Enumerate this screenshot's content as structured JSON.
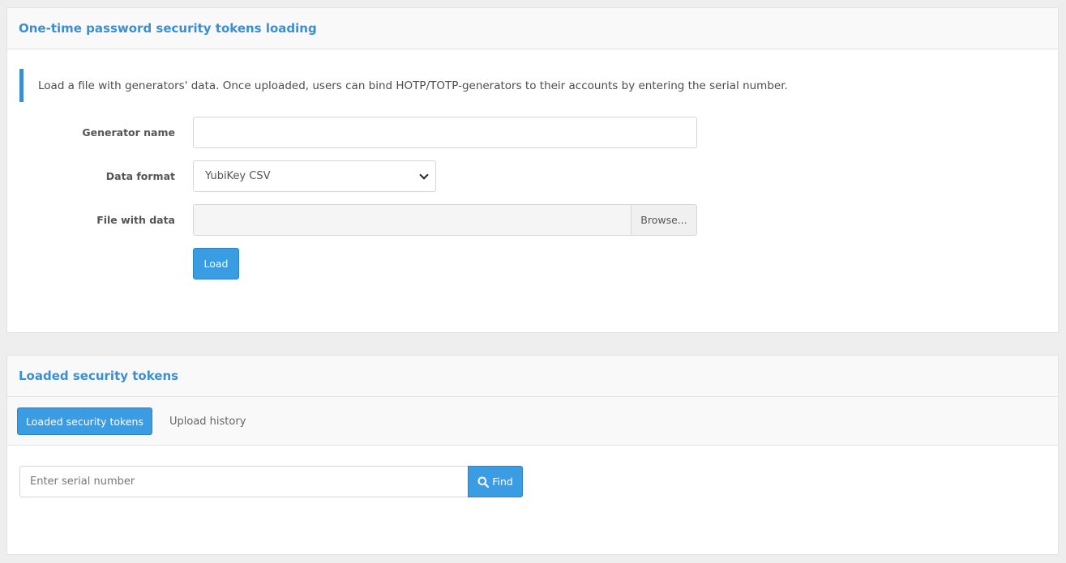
{
  "upload_panel": {
    "title": "One-time password security tokens loading",
    "info": "Load a file with generators' data. Once uploaded, users can bind HOTP/TOTP-generators to their accounts by entering the serial number.",
    "fields": {
      "generator_name_label": "Generator name",
      "generator_name_value": "",
      "data_format_label": "Data format",
      "data_format_value": "YubiKey CSV",
      "file_label": "File with data",
      "browse_label": "Browse..."
    },
    "load_label": "Load"
  },
  "tokens_panel": {
    "title": "Loaded security tokens",
    "tabs": [
      {
        "label": "Loaded security tokens",
        "active": true
      },
      {
        "label": "Upload history",
        "active": false
      }
    ],
    "search": {
      "placeholder": "Enter serial number",
      "find_label": "Find",
      "find_icon": "search-icon"
    }
  },
  "colors": {
    "accent": "#3a9ce2",
    "title": "#3a8fd1",
    "page_bg": "#eeeeee"
  }
}
